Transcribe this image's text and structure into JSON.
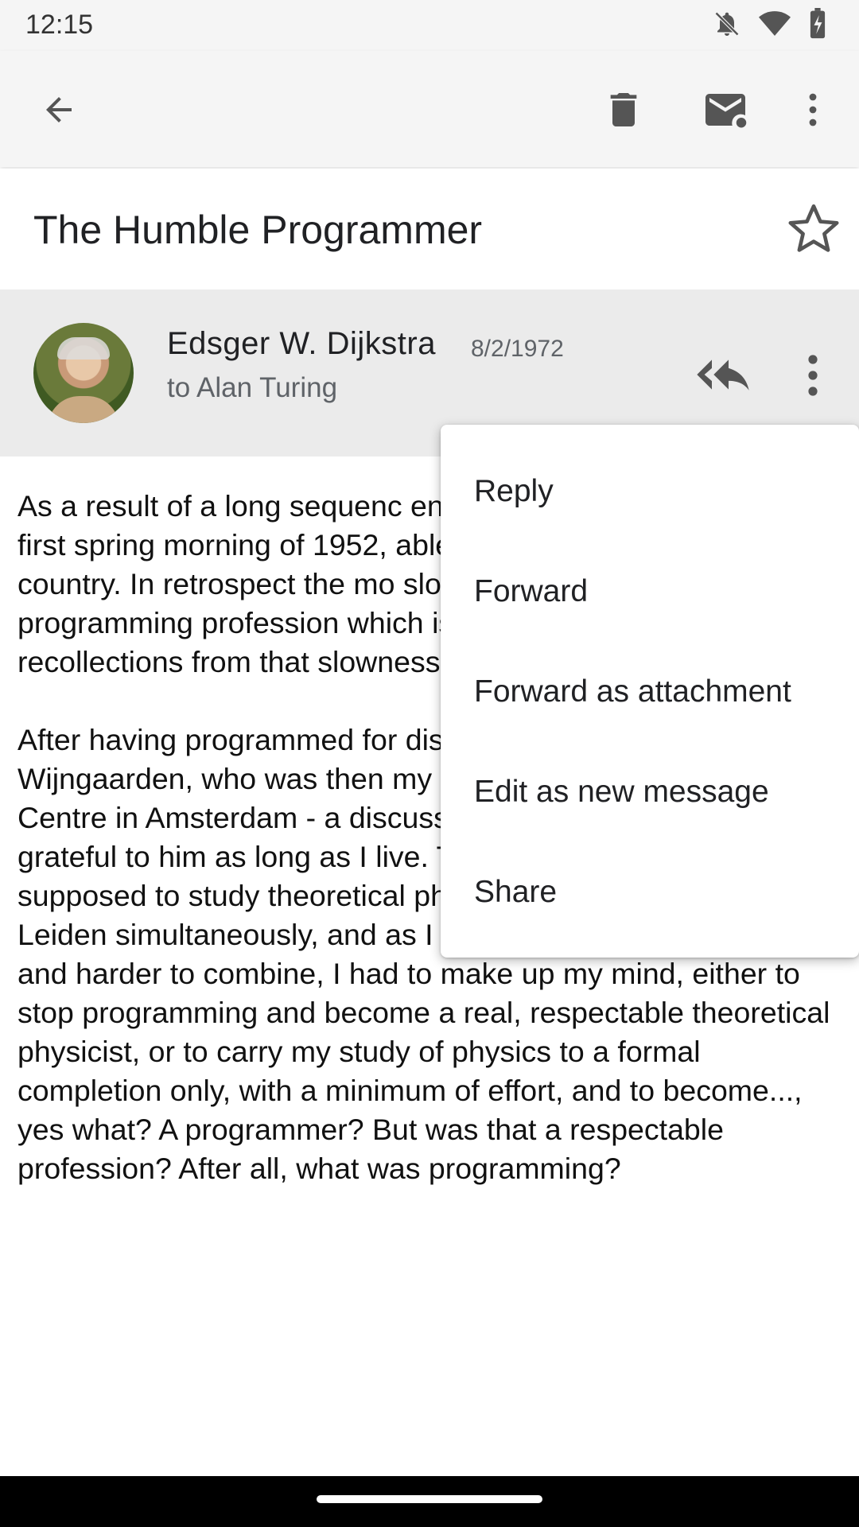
{
  "status_bar": {
    "time": "12:15",
    "icons": [
      "notifications-off-icon",
      "wifi-icon",
      "battery-charging-icon"
    ]
  },
  "toolbar": {
    "back_icon": "arrow-back-icon",
    "delete_icon": "trash-icon",
    "mark_unread_icon": "mail-unread-icon",
    "more_icon": "more-vert-icon"
  },
  "email": {
    "subject": "The Humble Programmer",
    "sender": "Edsger W. Dijkstra",
    "date": "8/2/1972",
    "recipient_line": "to Alan Turing",
    "body_paragraphs": [
      "As a result of a long sequenc entered the programming pro first spring morning of 1952, able to trace, I was the first D country. In retrospect the mo slowness with which, at least the programming profession which is now hard to believe. vivid recollections from that slowness beyond any doubt.",
      "After having programmed for discussion with van Wijngaarden, who was then my boss at the Mathematical Centre in Amsterdam - a discussion for which I shall remain grateful to him as long as I live. The point was that I was supposed to study theoretical physics at the University of Leiden simultaneously, and as I found the two activities harder and harder to combine, I had to make up my mind, either to stop programming and become a real, respectable theoretical physicist, or to carry my study of physics to a formal completion only, with a minimum of effort, and to become..., yes what? A programmer? But was that a respectable profession? After all, what was programming?"
    ]
  },
  "menu": {
    "items": [
      "Reply",
      "Forward",
      "Forward as attachment",
      "Edit as new message",
      "Share"
    ]
  },
  "colors": {
    "toolbar_bg": "#f5f5f5",
    "sender_bg": "#ebebeb",
    "icon_gray": "#5f6368"
  }
}
